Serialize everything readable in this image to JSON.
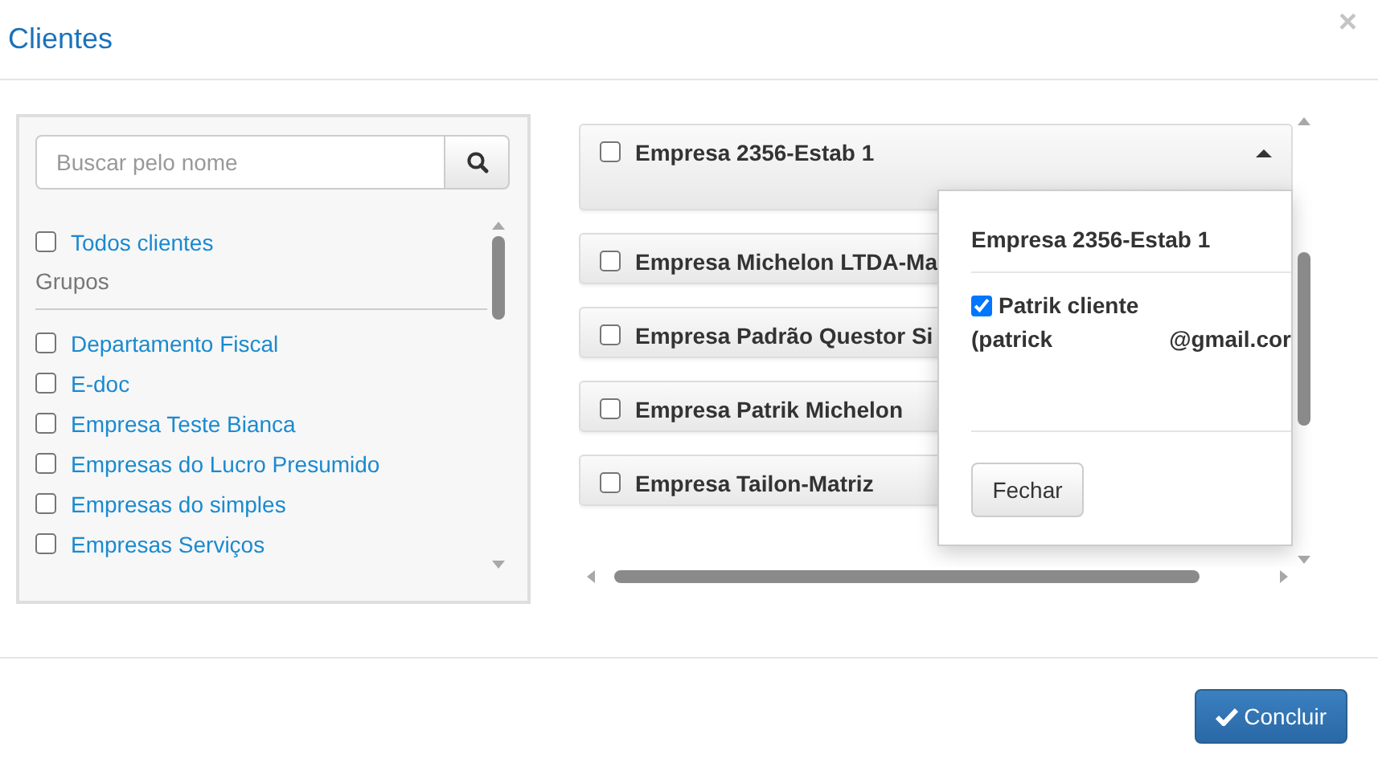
{
  "dialog": {
    "title": "Clientes",
    "close": "×"
  },
  "filter": {
    "search": {
      "placeholder": "Buscar pelo nome"
    },
    "all_clients": {
      "label": "Todos clientes",
      "checked": false
    },
    "groups_heading": "Grupos",
    "groups": [
      {
        "label": "Departamento Fiscal",
        "checked": false
      },
      {
        "label": "E-doc",
        "checked": false
      },
      {
        "label": "Empresa Teste Bianca",
        "checked": false
      },
      {
        "label": "Empresas do Lucro Presumido",
        "checked": false
      },
      {
        "label": "Empresas do simples",
        "checked": false
      },
      {
        "label": "Empresas Serviços",
        "checked": false
      }
    ]
  },
  "companies": [
    {
      "name": "Empresa 2356-Estab 1",
      "checked": false,
      "expanded": true
    },
    {
      "name": "Empresa Michelon LTDA-Ma",
      "checked": false
    },
    {
      "name": "Empresa Padrão Questor Si",
      "checked": false
    },
    {
      "name": "Empresa Patrik Michelon",
      "checked": false
    },
    {
      "name": "Empresa Tailon-Matriz",
      "checked": false
    }
  ],
  "popover": {
    "title": "Empresa 2356-Estab 1",
    "contact": {
      "name": "Patrik cliente",
      "checked": true,
      "email_start": "(patrick",
      "email_end": "@gmail.cor"
    },
    "close_button": "Fechar"
  },
  "footer": {
    "confirm_button": "Concluir"
  }
}
